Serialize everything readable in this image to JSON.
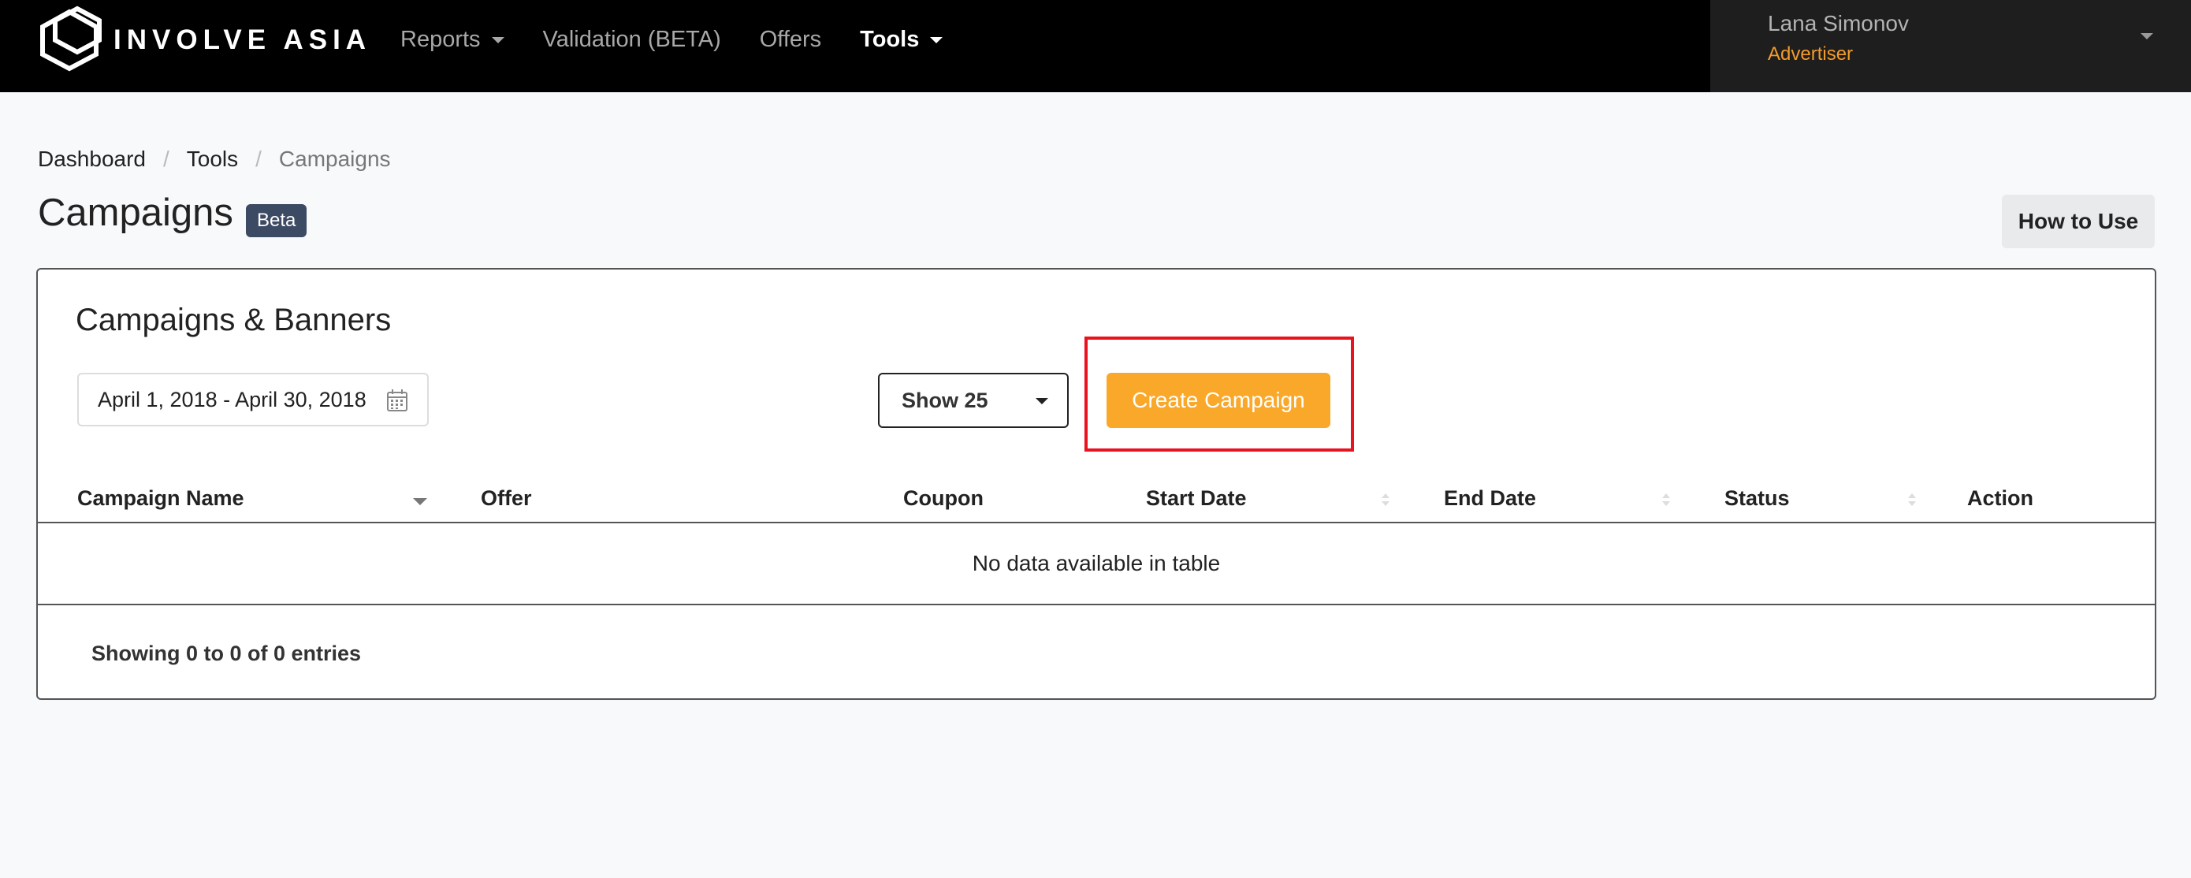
{
  "brand": {
    "name": "INVOLVE ASIA",
    "logo_icon": "hexagon-cube-icon"
  },
  "nav": {
    "items": [
      {
        "label": "Reports",
        "has_caret": true,
        "active": false
      },
      {
        "label": "Validation (BETA)",
        "has_caret": false,
        "active": false
      },
      {
        "label": "Offers",
        "has_caret": false,
        "active": false
      },
      {
        "label": "Tools",
        "has_caret": true,
        "active": true
      }
    ]
  },
  "user": {
    "name": "Lana Simonov",
    "role": "Advertiser"
  },
  "breadcrumb": [
    "Dashboard",
    "Tools",
    "Campaigns"
  ],
  "page": {
    "title": "Campaigns",
    "badge": "Beta",
    "how_to_use": "How to Use"
  },
  "card": {
    "title": "Campaigns & Banners",
    "date_range": "April 1, 2018 - April 30, 2018",
    "page_size": "Show 25",
    "create_button": "Create Campaign",
    "columns": [
      "Campaign Name",
      "Offer",
      "Coupon",
      "Start Date",
      "End Date",
      "Status",
      "Action"
    ],
    "empty_message": "No data available in table",
    "info": "Showing 0 to 0 of 0 entries"
  },
  "colors": {
    "accent": "#f9a82a",
    "badge": "#3d4a63",
    "highlight": "#e8131f",
    "role": "#f39b2a"
  }
}
